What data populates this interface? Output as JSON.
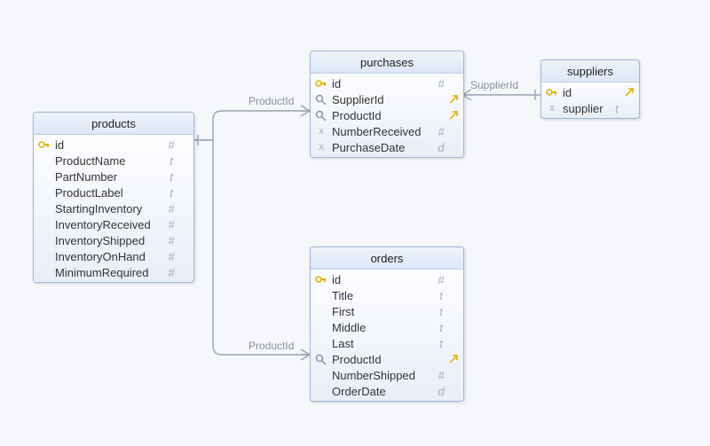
{
  "entities": {
    "products": {
      "title": "products",
      "columns": [
        {
          "icon": "pk",
          "name": "id",
          "type": "#",
          "fk": ""
        },
        {
          "icon": "",
          "name": "ProductName",
          "type": "t",
          "fk": ""
        },
        {
          "icon": "",
          "name": "PartNumber",
          "type": "t",
          "fk": ""
        },
        {
          "icon": "",
          "name": "ProductLabel",
          "type": "t",
          "fk": ""
        },
        {
          "icon": "",
          "name": "StartingInventory",
          "type": "#",
          "fk": ""
        },
        {
          "icon": "",
          "name": "InventoryReceived",
          "type": "#",
          "fk": ""
        },
        {
          "icon": "",
          "name": "InventoryShipped",
          "type": "#",
          "fk": ""
        },
        {
          "icon": "",
          "name": "InventoryOnHand",
          "type": "#",
          "fk": ""
        },
        {
          "icon": "",
          "name": "MinimumRequired",
          "type": "#",
          "fk": ""
        }
      ]
    },
    "purchases": {
      "title": "purchases",
      "columns": [
        {
          "icon": "pk",
          "name": "id",
          "type": "#",
          "fk": ""
        },
        {
          "icon": "fk",
          "name": "SupplierId",
          "type": "",
          "fk": "→"
        },
        {
          "icon": "fk",
          "name": "ProductId",
          "type": "",
          "fk": "→"
        },
        {
          "icon": "x",
          "name": "NumberReceived",
          "type": "#",
          "fk": ""
        },
        {
          "icon": "x",
          "name": "PurchaseDate",
          "type": "d",
          "fk": ""
        }
      ]
    },
    "orders": {
      "title": "orders",
      "columns": [
        {
          "icon": "pk",
          "name": "id",
          "type": "#",
          "fk": ""
        },
        {
          "icon": "",
          "name": "Title",
          "type": "t",
          "fk": ""
        },
        {
          "icon": "",
          "name": "First",
          "type": "t",
          "fk": ""
        },
        {
          "icon": "",
          "name": "Middle",
          "type": "t",
          "fk": ""
        },
        {
          "icon": "",
          "name": "Last",
          "type": "t",
          "fk": ""
        },
        {
          "icon": "fk",
          "name": "ProductId",
          "type": "",
          "fk": "→"
        },
        {
          "icon": "",
          "name": "NumberShipped",
          "type": "#",
          "fk": ""
        },
        {
          "icon": "",
          "name": "OrderDate",
          "type": "d",
          "fk": ""
        }
      ]
    },
    "suppliers": {
      "title": "suppliers",
      "columns": [
        {
          "icon": "pk",
          "name": "id",
          "type": "",
          "fk": "→"
        },
        {
          "icon": "x",
          "name": "supplier",
          "type": "t",
          "fk": ""
        }
      ]
    }
  },
  "relations": {
    "purchases_products": {
      "label": "ProductId"
    },
    "orders_products": {
      "label": "ProductId"
    },
    "purchases_suppliers": {
      "label": "SupplierId"
    }
  }
}
